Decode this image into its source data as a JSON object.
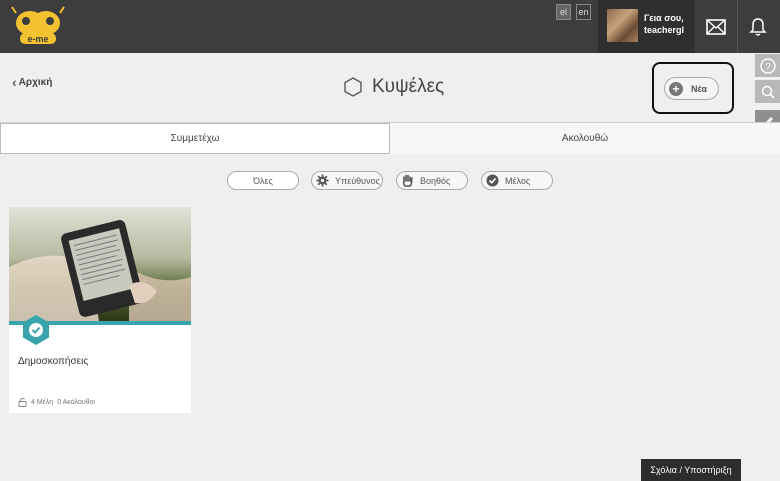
{
  "topbar": {
    "logo_text": "e-me",
    "languages": [
      "el",
      "en"
    ],
    "greeting_line1": "Γεια σου,",
    "greeting_line2": "teachergl"
  },
  "header": {
    "back_label": "Αρχική",
    "title": "Κυψέλες",
    "new_button_label": "Νέα"
  },
  "tabs": [
    {
      "label": "Συμμετέχω",
      "active": true
    },
    {
      "label": "Ακολουθώ",
      "active": false
    }
  ],
  "filters": [
    {
      "label": "Όλες",
      "icon": "none"
    },
    {
      "label": "Υπεύθυνος",
      "icon": "gear-icon"
    },
    {
      "label": "Βοηθός",
      "icon": "hand-icon"
    },
    {
      "label": "Μέλος",
      "icon": "check-circle-icon"
    }
  ],
  "card": {
    "title": "Δημοσκοπήσεις",
    "members": "4 Μέλη",
    "followers": "0 Ακόλουθοι",
    "accent_color": "#3aa4ad"
  },
  "feedback_label": "Σχόλια / Υποστήριξη",
  "colors": {
    "topbar": "#3d3d3d",
    "accent": "#3aa4ad",
    "background": "#efefef"
  }
}
